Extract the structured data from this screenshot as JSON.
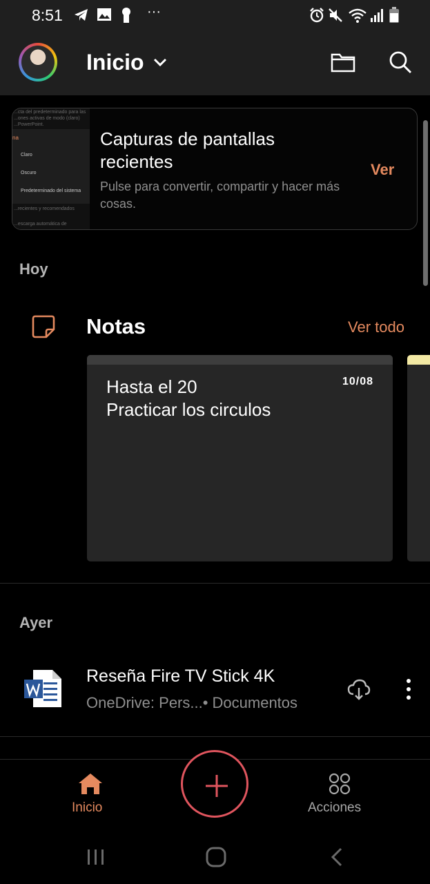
{
  "status_bar": {
    "time": "8:51",
    "overflow": "···",
    "icons": [
      "telegram-icon",
      "gallery-icon",
      "keyhole-icon",
      "alarm-icon",
      "mute-icon",
      "wifi-icon",
      "signal-icon",
      "battery-icon"
    ]
  },
  "header": {
    "title": "Inicio",
    "chevron_icon": "chevron-down-icon",
    "folder_icon": "folder-icon",
    "search_icon": "search-icon"
  },
  "screenshot_card": {
    "thumbnail_lines": {
      "l1": "...cta del predeterminado para las",
      "l2": "...ones activas de modo (claro)",
      "l3": "...PowerPoint.",
      "accent": "na",
      "opt1": "Claro",
      "opt2": "Oscuro",
      "opt3": "Predeterminado del sistema",
      "l4": "...recientes y recomendados",
      "l5": "...escarga automática de"
    },
    "title": "Capturas de pantallas recientes",
    "subtitle": "Pulse para convertir, compartir y hacer más cosas.",
    "action": "Ver"
  },
  "today": {
    "label": "Hoy"
  },
  "notes": {
    "title": "Notas",
    "see_all": "Ver todo",
    "cards": [
      {
        "line1": "Hasta el 20",
        "line2": "Practicar los circulos",
        "date": "10/08"
      }
    ]
  },
  "yesterday": {
    "label": "Ayer",
    "files": [
      {
        "title": "Reseña Fire TV Stick 4K",
        "location": "OneDrive: Pers...• Documentos",
        "icon": "word-doc-icon"
      }
    ]
  },
  "bottom_nav": {
    "home_label": "Inicio",
    "actions_label": "Acciones"
  },
  "colors": {
    "accent": "#e58a5f",
    "fab_ring": "#e0555e",
    "background": "#000000",
    "surface": "#1f1f1f",
    "note_card": "#262626",
    "muted_text": "#8f8f8f"
  }
}
